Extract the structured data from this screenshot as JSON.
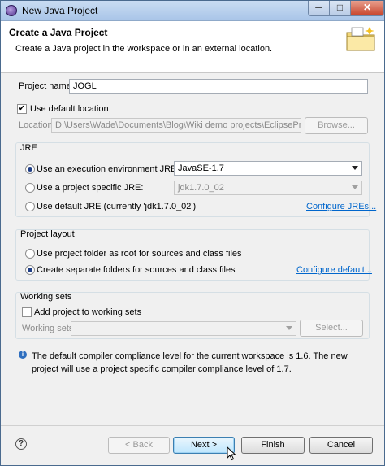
{
  "window": {
    "title": "New Java Project",
    "controls": {
      "min": "─",
      "max": "□",
      "close": "✕"
    }
  },
  "banner": {
    "title": "Create a Java Project",
    "description": "Create a Java project in the workspace or in an external location.",
    "icon": "folder-plus-icon"
  },
  "project": {
    "name_label": "Project name:",
    "name_value": "JOGL"
  },
  "location": {
    "use_default_label": "Use default location",
    "use_default_checked": true,
    "location_label": "Location:",
    "location_value": "D:\\Users\\Wade\\Documents\\Blog\\Wiki demo projects\\EclipseProjects\\",
    "browse_label": "Browse..."
  },
  "jre": {
    "group_title": "JRE",
    "options": [
      {
        "label": "Use an execution environment JRE:",
        "selected": true
      },
      {
        "label": "Use a project specific JRE:",
        "selected": false
      },
      {
        "label": "Use default JRE (currently 'jdk1.7.0_02')",
        "selected": false
      }
    ],
    "env_value": "JavaSE-1.7",
    "specific_value": "jdk1.7.0_02",
    "configure_link": "Configure JREs..."
  },
  "layout": {
    "group_title": "Project layout",
    "options": [
      {
        "label": "Use project folder as root for sources and class files",
        "selected": false
      },
      {
        "label": "Create separate folders for sources and class files",
        "selected": true
      }
    ],
    "configure_link": "Configure default..."
  },
  "working_sets": {
    "group_title": "Working sets",
    "add_label": "Add project to working sets",
    "add_checked": false,
    "sets_label": "Working sets:",
    "select_label": "Select..."
  },
  "info": {
    "message": "The default compiler compliance level for the current workspace is 1.6. The new project will use a project specific compiler compliance level of 1.7."
  },
  "footer": {
    "back": "< Back",
    "next": "Next >",
    "finish": "Finish",
    "cancel": "Cancel",
    "help": "?"
  }
}
